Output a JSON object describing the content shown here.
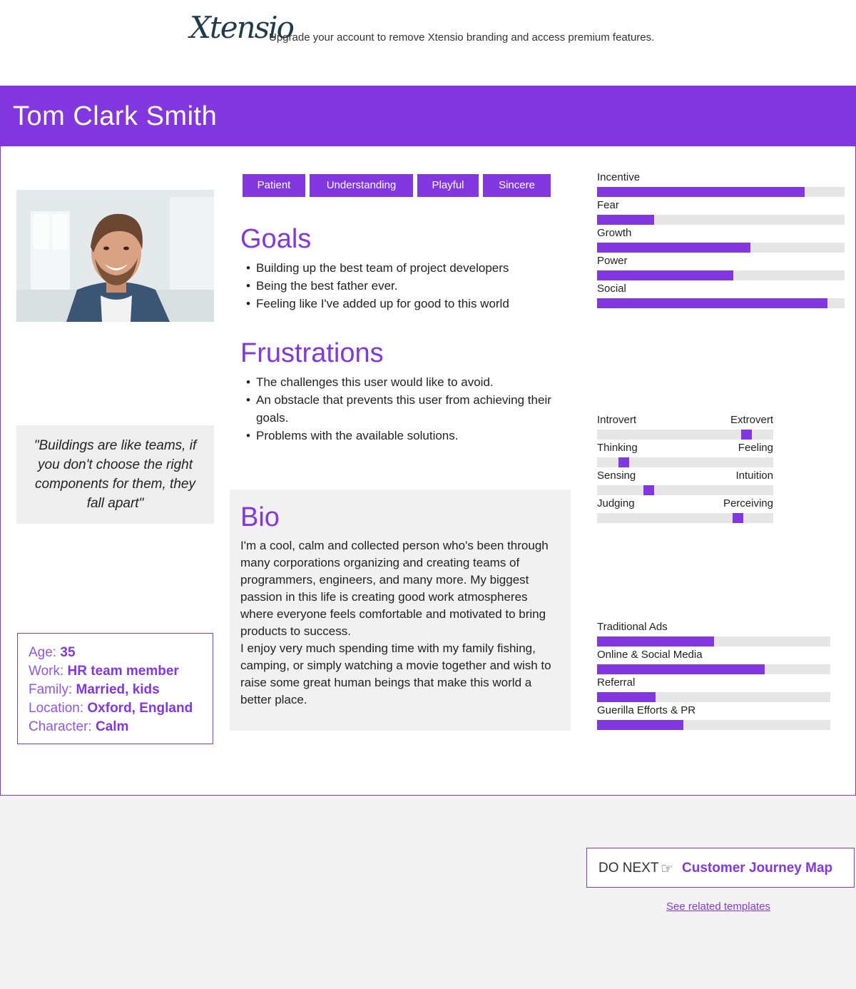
{
  "banner": {
    "logo": "Xtensio",
    "message": "Upgrade your account to remove Xtensio branding and access premium features."
  },
  "persona": {
    "name": "Tom Clark Smith",
    "quote": "\"Buildings are like teams, if you don't choose the right components for them, they fall apart\"",
    "facts": [
      {
        "label": "Age:",
        "value": "35"
      },
      {
        "label": "Work:",
        "value": "HR team member"
      },
      {
        "label": "Family:",
        "value": "Married, kids"
      },
      {
        "label": "Location:",
        "value": "Oxford, England"
      },
      {
        "label": "Character:",
        "value": "Calm"
      }
    ],
    "tags": [
      "Patient",
      "Understanding",
      "Playful",
      "Sincere"
    ],
    "goals": {
      "title": "Goals",
      "items": [
        "Building up the best team of project developers",
        "Being the best father ever.",
        "Feeling like I've added up for good to this world"
      ]
    },
    "frustrations": {
      "title": "Frustrations",
      "items": [
        "The challenges this user would like to avoid.",
        "An obstacle that prevents this user from achieving their goals.",
        "Problems with the available solutions."
      ]
    },
    "bio": {
      "title": "Bio",
      "paragraphs": [
        "I'm a cool, calm and collected person who's been through many corporations organizing and creating teams of programmers, engineers, and many more. My biggest passion in this life is creating good work atmospheres where everyone feels comfortable and motivated to bring products to success.",
        "I enjoy very much spending time with my family fishing, camping, or simply watching a movie together and wish to raise some great human beings that make this world a better place."
      ]
    },
    "motivations": [
      {
        "label": "Incentive",
        "level": 0.84
      },
      {
        "label": "Fear",
        "level": 0.23
      },
      {
        "label": "Growth",
        "level": 0.62
      },
      {
        "label": "Power",
        "level": 0.55
      },
      {
        "label": "Social",
        "level": 0.93
      }
    ],
    "personality": [
      {
        "left": "Introvert",
        "right": "Extrovert",
        "level": 0.87
      },
      {
        "left": "Thinking",
        "right": "Feeling",
        "level": 0.13
      },
      {
        "left": "Sensing",
        "right": "Intuition",
        "level": 0.28
      },
      {
        "left": "Judging",
        "right": "Perceiving",
        "level": 0.82
      }
    ],
    "channels": [
      {
        "label": "Traditional Ads",
        "level": 0.5
      },
      {
        "label": "Online & Social Media",
        "level": 0.72
      },
      {
        "label": "Referral",
        "level": 0.25
      },
      {
        "label": "Guerilla Efforts & PR",
        "level": 0.37
      }
    ]
  },
  "footer": {
    "do_next_label": "DO NEXT",
    "do_next_icon": "hand-pointing-right-icon",
    "do_next_target": "Customer Journey Map",
    "related_link": "See related templates"
  },
  "colors": {
    "accent": "#8237e0",
    "track": "#e6e6e6"
  }
}
